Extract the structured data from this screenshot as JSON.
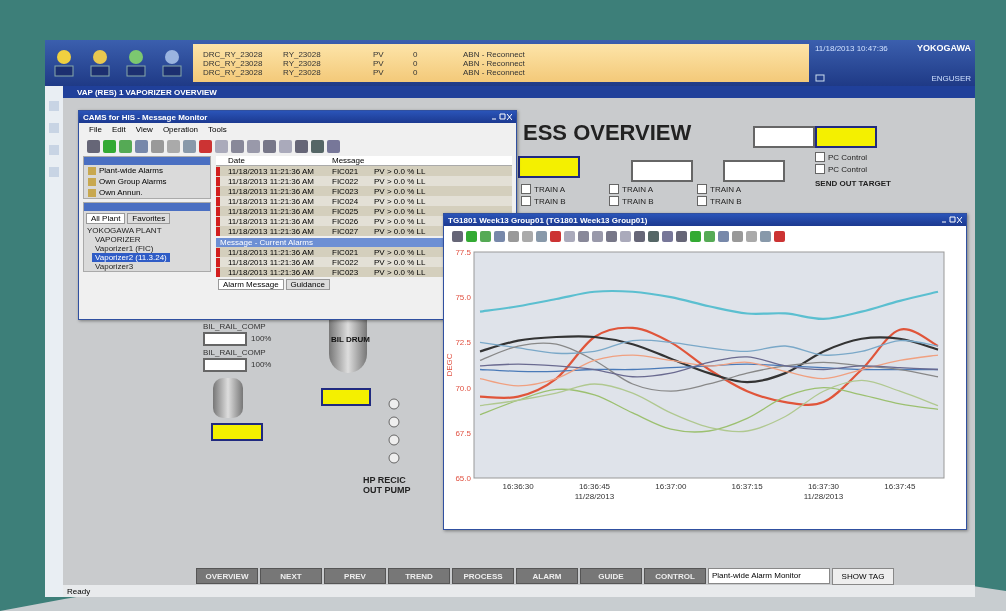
{
  "top_bar": {
    "alarm_rows": [
      {
        "tag": "DRC_RY_23028",
        "unit": "RY_23028",
        "item": "PV",
        "cond": "0",
        "text": "ABN - Reconnect"
      },
      {
        "tag": "DRC_RY_23028",
        "unit": "RY_23028",
        "item": "PV",
        "cond": "0",
        "text": "ABN - Reconnect"
      },
      {
        "tag": "DRC_RY_23028",
        "unit": "RY_23028",
        "item": "PV",
        "cond": "0",
        "text": "ABN - Reconnect"
      }
    ],
    "date": "11/18/2013 10:47:36",
    "brand": "YOKOGAWA",
    "user": "ENGUSER"
  },
  "main_window": {
    "title": "VAP (RES) 1 VAPORIZER OVERVIEW",
    "heading": "ESS OVERVIEW",
    "controls": [
      {
        "label": "PC Control",
        "checked": false
      },
      {
        "label": "PC Control",
        "checked": false
      }
    ],
    "trains": [
      {
        "label": "TRAIN A",
        "checked": false
      },
      {
        "label": "TRAIN B",
        "checked": false
      },
      {
        "label": "TRAIN A",
        "checked": false
      },
      {
        "label": "TRAIN B",
        "checked": false
      },
      {
        "label": "TRAIN A",
        "checked": false
      },
      {
        "label": "TRAIN B",
        "checked": false
      }
    ],
    "pump_label": "HP RECIC OUT PUMP",
    "drum_label": "BIL DRUM",
    "send_out": "SEND OUT TARGET",
    "readouts": [
      {
        "tag": "BIL_RAIL_COMP",
        "value": "100%"
      },
      {
        "tag": "BIL_RAIL_COMP",
        "value": "100%"
      }
    ],
    "nav_buttons": [
      "OVERVIEW",
      "NEXT",
      "PREV",
      "TREND",
      "PROCESS",
      "ALARM",
      "GUIDE",
      "CONTROL"
    ],
    "alarm_monitor_field": "Plant-wide Alarm Monitor",
    "show_tag": "SHOW TAG",
    "status": "Ready"
  },
  "message_monitor": {
    "title": "CAMS for HIS - Message Monitor",
    "menu": [
      "File",
      "Edit",
      "View",
      "Operation",
      "Tools"
    ],
    "filters": [
      {
        "label": "Plant-wide Alarms"
      },
      {
        "label": "Own Group Alarms"
      },
      {
        "label": "Own Annun."
      }
    ],
    "tree_tabs": [
      {
        "label": "All Plant",
        "selected": true
      },
      {
        "label": "Favorites",
        "selected": false
      }
    ],
    "tree": [
      {
        "label": "YOKOGAWA PLANT",
        "expanded": true,
        "children": [
          {
            "label": "VAPORIZER",
            "selected": false
          },
          {
            "label": "Vaporizer1 (FIC)",
            "selected": false
          },
          {
            "label": "Vaporizer2 (11.3.24)",
            "selected": true
          },
          {
            "label": "Vaporizer3",
            "selected": false
          }
        ]
      }
    ],
    "columns": [
      "Date",
      "Message"
    ],
    "rows": [
      {
        "date": "11/18/2013 11:21:36 AM",
        "tag": "FIC021",
        "msg": "PV > 0.0 % LL"
      },
      {
        "date": "11/18/2013 11:21:36 AM",
        "tag": "FIC022",
        "msg": "PV > 0.0 % LL"
      },
      {
        "date": "11/18/2013 11:21:36 AM",
        "tag": "FIC023",
        "msg": "PV > 0.0 % LL"
      },
      {
        "date": "11/18/2013 11:21:36 AM",
        "tag": "FIC024",
        "msg": "PV > 0.0 % LL"
      },
      {
        "date": "11/18/2013 11:21:36 AM",
        "tag": "FIC025",
        "msg": "PV > 0.0 % LL"
      },
      {
        "date": "11/18/2013 11:21:36 AM",
        "tag": "FIC026",
        "msg": "PV > 0.0 % LL"
      },
      {
        "date": "11/18/2013 11:21:36 AM",
        "tag": "FIC027",
        "msg": "PV > 0.0 % LL"
      }
    ],
    "lower_title": "Message - Current Alarms",
    "lower_rows": [
      {
        "date": "11/18/2013 11:21:36 AM",
        "tag": "FIC021",
        "msg": "PV > 0.0 % LL"
      },
      {
        "date": "11/18/2013 11:21:36 AM",
        "tag": "FIC022",
        "msg": "PV > 0.0 % LL"
      },
      {
        "date": "11/18/2013 11:21:36 AM",
        "tag": "FIC023",
        "msg": "PV > 0.0 % LL"
      }
    ],
    "bottom_tabs": [
      {
        "label": "Alarm Message",
        "selected": true
      },
      {
        "label": "Guidance",
        "selected": false
      }
    ]
  },
  "trend": {
    "title": "TG1801 Week13 Group01 (TG1801 Week13 Group01)",
    "chart_data": {
      "type": "line",
      "ylabel": "DEGC",
      "categories": [
        null,
        "16:36:30",
        null,
        "16:36:45\n11/28/2013",
        null,
        "16:37:00",
        null,
        "16:37:15",
        null,
        "16:37:30\n11/28/2013",
        null,
        "16:37:45",
        null
      ],
      "ylim": [
        65,
        77.5
      ],
      "yticks": [
        {
          "value": 77.5,
          "label": "77.5"
        },
        {
          "value": 75,
          "label": "75.0"
        },
        {
          "value": 72.5,
          "label": "72.5"
        },
        {
          "value": 70,
          "label": "70.0"
        },
        {
          "value": 67.5,
          "label": "67.5"
        },
        {
          "value": 65,
          "label": "65.0"
        }
      ],
      "series": [
        {
          "color": "#5bbfd0",
          "values": [
            74.2,
            74.5,
            74.9,
            75.3,
            75.3,
            75.0,
            74.5,
            74.1,
            74.1,
            73.8,
            74.2,
            74.8,
            75.3
          ]
        },
        {
          "color": "#e0553a",
          "values": [
            69.5,
            69.5,
            70.5,
            72.8,
            73.3,
            72.5,
            71.0,
            69.8,
            69.2,
            69.2,
            71.0,
            73.2,
            72.3
          ]
        },
        {
          "color": "#333333",
          "values": [
            72.0,
            72.6,
            72.8,
            72.8,
            72.4,
            71.6,
            70.8,
            70.3,
            70.8,
            72.0,
            72.7,
            72.7,
            72.1
          ]
        },
        {
          "color": "#4a7ab8",
          "values": [
            71.0,
            70.9,
            70.9,
            71.0,
            71.0,
            71.1,
            71.2,
            71.3,
            71.2,
            71.1,
            71.0,
            71.0,
            71.0
          ]
        },
        {
          "color": "#7aa8c8",
          "values": [
            72.5,
            72.2,
            71.9,
            72.0,
            72.6,
            72.5,
            72.2,
            72.0,
            72.3,
            71.8,
            72.0,
            72.6,
            72.3
          ]
        },
        {
          "color": "#888888",
          "values": [
            71.5,
            72.3,
            72.4,
            71.5,
            70.2,
            69.8,
            70.2,
            70.8,
            71.2,
            71.4,
            71.2,
            71.0,
            70.6
          ]
        },
        {
          "color": "#f0a080",
          "values": [
            70.5,
            70.1,
            70.5,
            71.5,
            71.8,
            71.5,
            71.2,
            71.4,
            70.9,
            70.5,
            71.0,
            71.5,
            71.8
          ]
        },
        {
          "color": "#9cc070",
          "values": [
            68.5,
            69.3,
            69.9,
            69.6,
            68.6,
            67.7,
            67.6,
            68.3,
            69.5,
            70.0,
            69.6,
            69.1,
            68.8
          ]
        },
        {
          "color": "#b0c890",
          "values": [
            69.0,
            69.3,
            69.7,
            70.2,
            69.7,
            68.6,
            67.8,
            67.6,
            68.4,
            69.8,
            70.4,
            69.8,
            69.0
          ]
        },
        {
          "color": "#6a6a90",
          "values": [
            71.2,
            71.3,
            71.2,
            71.0,
            70.6,
            70.8,
            71.4,
            71.7,
            71.2,
            71.0,
            71.2,
            71.1,
            71.0
          ]
        }
      ]
    }
  }
}
